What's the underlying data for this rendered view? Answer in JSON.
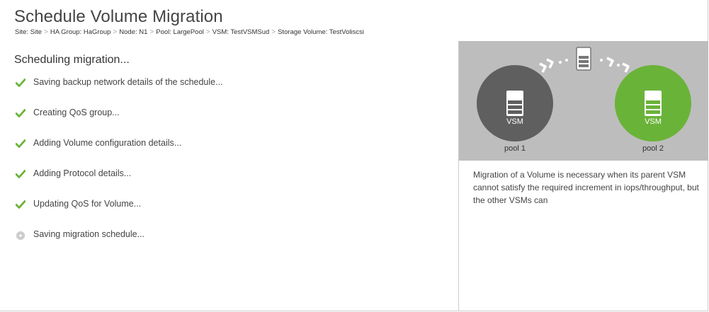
{
  "header": {
    "title": "Schedule Volume Migration",
    "breadcrumb": [
      "Site: Site",
      "HA Group: HaGroup",
      "Node: N1",
      "Pool: LargePool",
      "VSM: TestVSMSud",
      "Storage Volume: TestVoliscsi"
    ],
    "separator": ">"
  },
  "progress": {
    "heading": "Scheduling migration...",
    "steps": [
      {
        "label": "Saving backup network details of the schedule...",
        "status": "done",
        "icon": "check-icon"
      },
      {
        "label": "Creating QoS group...",
        "status": "done",
        "icon": "check-icon"
      },
      {
        "label": "Adding Volume configuration details...",
        "status": "done",
        "icon": "check-icon"
      },
      {
        "label": "Adding Protocol details...",
        "status": "done",
        "icon": "check-icon"
      },
      {
        "label": "Updating QoS for Volume...",
        "status": "done",
        "icon": "check-icon"
      },
      {
        "label": "Saving migration schedule...",
        "status": "in-progress",
        "icon": "spinner-icon"
      }
    ]
  },
  "diagram": {
    "source": {
      "vsm_label": "VSM",
      "pool_label": "pool 1",
      "color": "#5f5f5f"
    },
    "target": {
      "vsm_label": "VSM",
      "pool_label": "pool 2",
      "color": "#6ab339"
    },
    "background": "#bdbdbd",
    "check_color": "#6ab339"
  },
  "info": {
    "description": "Migration of a Volume is necessary when its parent VSM cannot satisfy the required increment in iops/throughput, but the other VSMs can"
  }
}
